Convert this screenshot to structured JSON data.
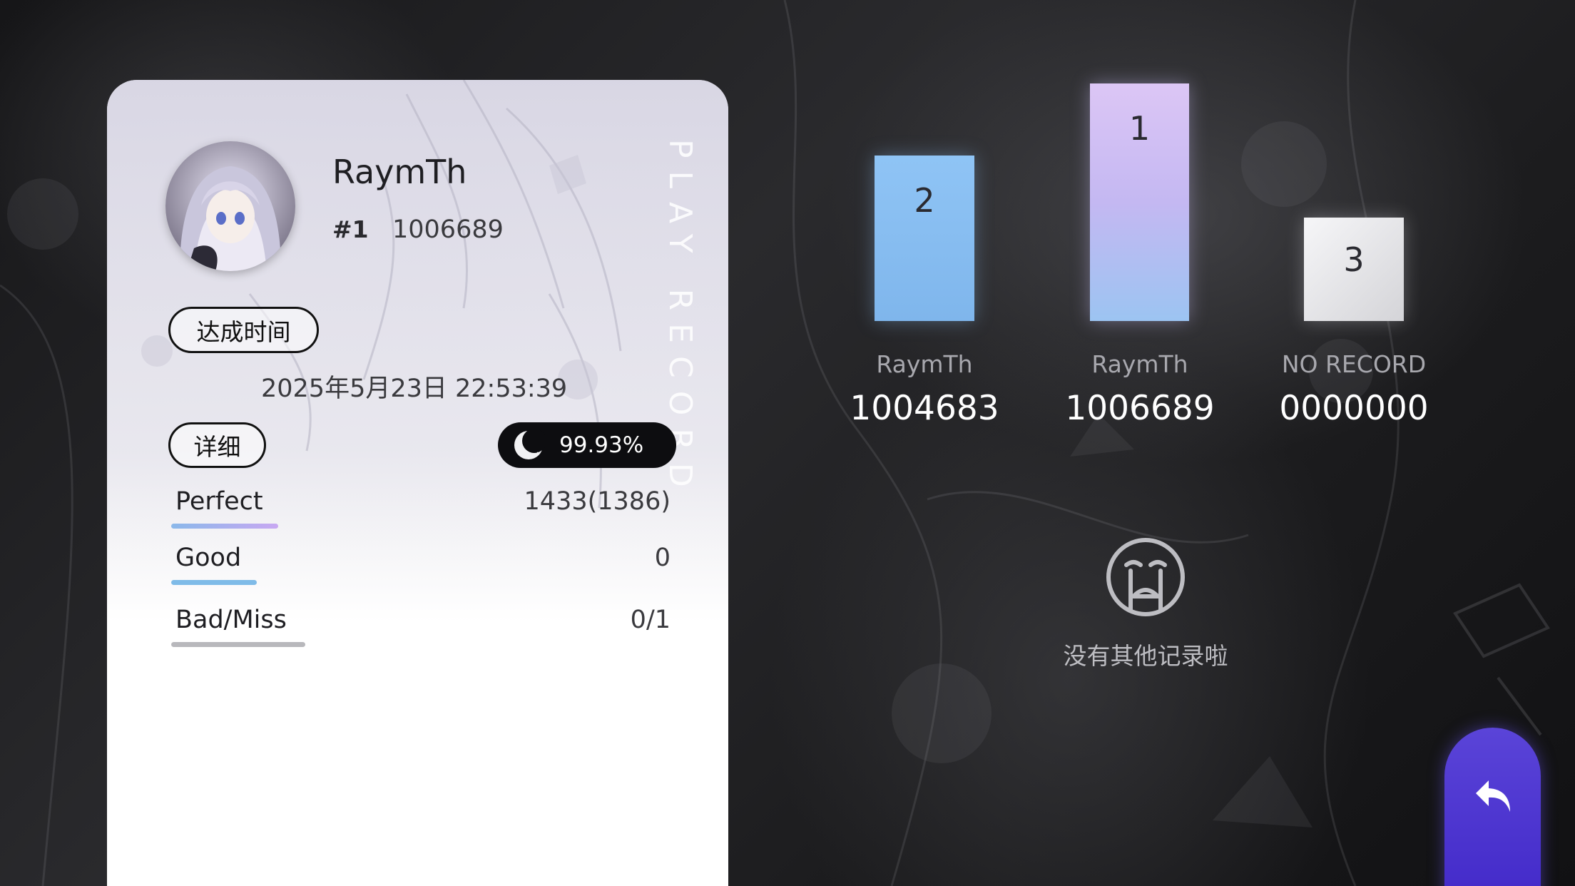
{
  "record_card": {
    "vertical_title": "PLAY RECORD",
    "player_name": "RaymTh",
    "rank": "#1",
    "best_score": "1006689",
    "achieve_label": "达成时间",
    "achieve_time": "2025年5月23日 22:53:39",
    "detail_label": "详细",
    "accuracy": "99.93%",
    "judgements": [
      {
        "label": "Perfect",
        "value": "1433(1386)",
        "color": "#b8a8f0"
      },
      {
        "label": "Good",
        "value": "0",
        "color": "#7fbbe8"
      },
      {
        "label": "Bad/Miss",
        "value": "0/1",
        "color": "#b8b8bc"
      }
    ]
  },
  "podium": [
    {
      "place": "2",
      "name": "RaymTh",
      "score": "1004683"
    },
    {
      "place": "1",
      "name": "RaymTh",
      "score": "1006689"
    },
    {
      "place": "3",
      "name": "NO RECORD",
      "score": "0000000"
    }
  ],
  "empty_message": "没有其他记录啦",
  "icons": {
    "accuracy": "moon-icon",
    "empty": "crying-face-icon",
    "back": "back-arrow-icon"
  },
  "colors": {
    "second_place": "#8fc4f5",
    "first_place_top": "#dcc6f5",
    "first_place_bottom": "#9cc4f2",
    "third_place": "#e8e8ea",
    "back_button": "#4a34d0"
  }
}
